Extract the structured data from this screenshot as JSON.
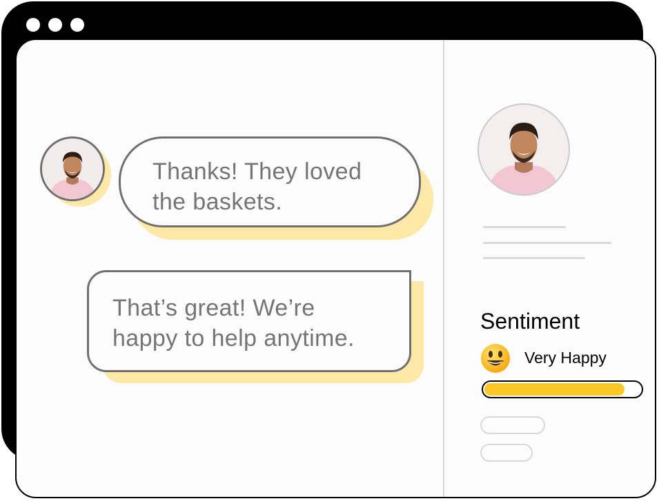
{
  "window": {
    "controls": [
      "window-dot",
      "window-dot",
      "window-dot"
    ]
  },
  "chat": {
    "messages": [
      {
        "sender": "customer",
        "text": "Thanks! They loved\nthe baskets."
      },
      {
        "sender": "agent",
        "text": "That’s great! We’re\nhappy to help anytime."
      }
    ]
  },
  "profile": {
    "avatar_icon": "person-avatar",
    "placeholder_lines": 3
  },
  "sentiment": {
    "title": "Sentiment",
    "emoji_icon": "smiley-face-icon",
    "label": "Very Happy",
    "level_percent": 90,
    "bar_color": "#fcc727"
  },
  "colors": {
    "highlight": "#fde8a7",
    "bubble_border": "#6f6f6f",
    "text": "#747474"
  }
}
